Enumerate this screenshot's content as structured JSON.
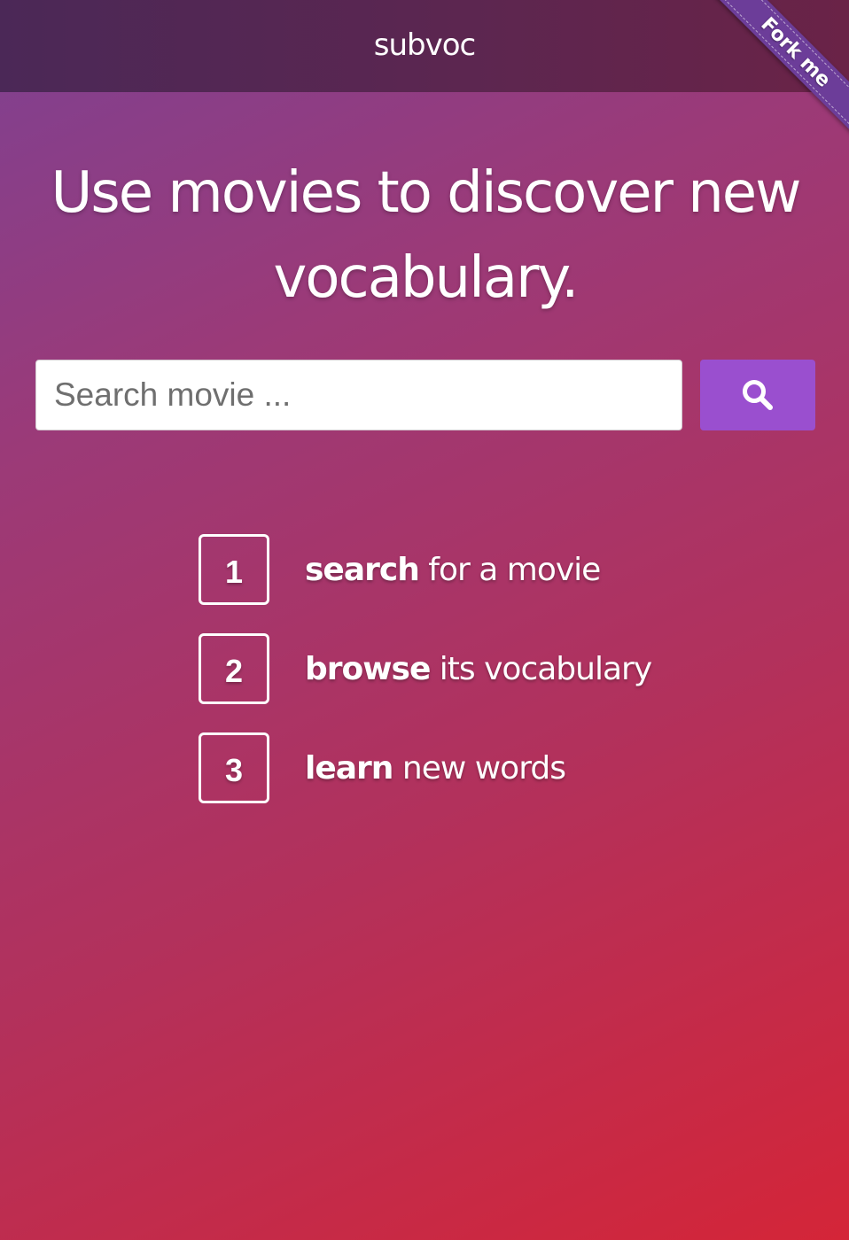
{
  "navbar": {
    "brand": "subvoc"
  },
  "ribbon": {
    "label": "Fork me"
  },
  "hero": {
    "headline": "Use movies to discover new vocabulary."
  },
  "search": {
    "placeholder": "Search movie ...",
    "value": "",
    "button_icon": "search-icon"
  },
  "steps": [
    {
      "number": "1",
      "keyword": "search",
      "rest": " for a movie"
    },
    {
      "number": "2",
      "keyword": "browse",
      "rest": " its vocabulary"
    },
    {
      "number": "3",
      "keyword": "learn",
      "rest": " new words"
    }
  ],
  "colors": {
    "navbar": "#55284f",
    "button": "#9a4fcf",
    "ribbon": "#6c3d99",
    "gradient_start": "#7e4192",
    "gradient_end": "#d42538"
  }
}
